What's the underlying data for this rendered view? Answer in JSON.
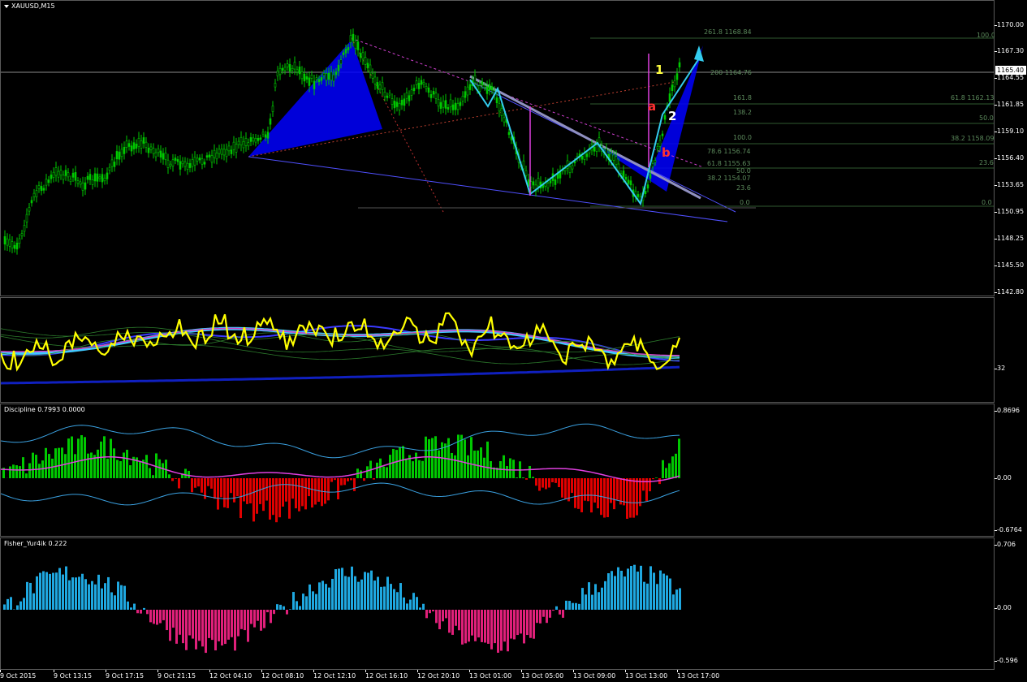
{
  "main": {
    "title": "XAUUSD,M15",
    "price_ticks": [
      "1170.00",
      "1167.30",
      "1164.55",
      "1161.85",
      "1159.10",
      "1156.40",
      "1153.65",
      "1150.95",
      "1148.25",
      "1145.50",
      "1142.80"
    ],
    "current_price": "1165.40",
    "fib_levels": [
      {
        "text": "261.8 1168.84"
      },
      {
        "text": "100.0"
      },
      {
        "text": "200 1164.76"
      },
      {
        "text": "161.8"
      },
      {
        "text": "61.8 1162.13"
      },
      {
        "text": "138.2"
      },
      {
        "text": "50.0"
      },
      {
        "text": "100.0"
      },
      {
        "text": "38.2 1158.09"
      },
      {
        "text": "78.6 1156.74"
      },
      {
        "text": "61.8 1155.63"
      },
      {
        "text": "23.6"
      },
      {
        "text": "50.0"
      },
      {
        "text": "38.2 1154.07"
      },
      {
        "text": "23.6"
      },
      {
        "text": "0.0"
      },
      {
        "text": "0.0"
      }
    ],
    "wave_labels": {
      "one": "1",
      "two": "2",
      "a": "a",
      "b": "b"
    }
  },
  "osc1": {
    "tick": "32"
  },
  "discipline": {
    "title": "Discipline 0.7993 0.0000",
    "ticks": [
      "0.8696",
      "0.00",
      "-0.6764"
    ]
  },
  "fisher": {
    "title": "Fisher_Yur4ik 0.222",
    "ticks": [
      "0.706",
      "0.00",
      "-0.596"
    ]
  },
  "time_axis": [
    "9 Oct 2015",
    "9 Oct 13:15",
    "9 Oct 17:15",
    "9 Oct 21:15",
    "12 Oct 04:10",
    "12 Oct 08:10",
    "12 Oct 12:10",
    "12 Oct 16:10",
    "12 Oct 20:10",
    "13 Oct 01:00",
    "13 Oct 05:00",
    "13 Oct 09:00",
    "13 Oct 13:00",
    "13 Oct 17:00"
  ],
  "colors": {
    "bull": "#00c800",
    "bear": "#e00000",
    "fisher_pos": "#1fa8e0",
    "fisher_neg": "#e0207a",
    "pattern": "#0000ff",
    "wave": "#33ccee",
    "osc_yellow": "#ffff00"
  }
}
